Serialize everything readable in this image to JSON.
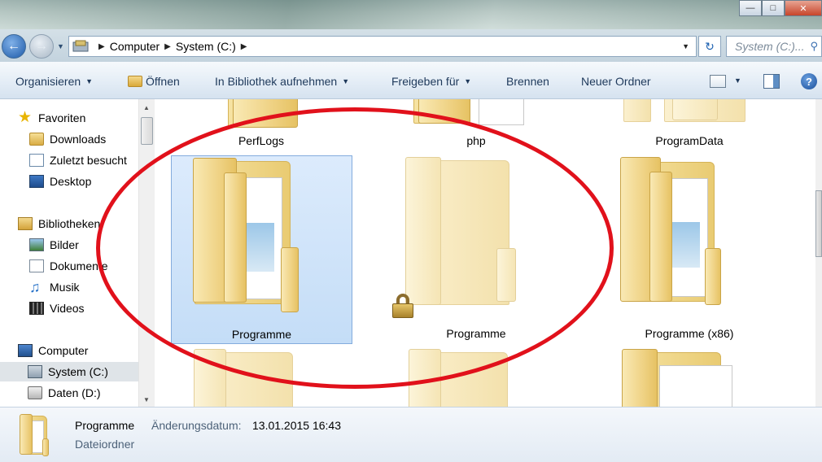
{
  "address": {
    "crumbs": [
      "Computer",
      "System (C:)"
    ],
    "search_placeholder": "System (C:)..."
  },
  "toolbar": {
    "organize": "Organisieren",
    "open": "Öffnen",
    "include_library": "In Bibliothek aufnehmen",
    "share": "Freigeben für",
    "burn": "Brennen",
    "new_folder": "Neuer Ordner"
  },
  "navigation": {
    "favorites_header": "Favoriten",
    "favorites": [
      "Downloads",
      "Zuletzt besucht",
      "Desktop"
    ],
    "libraries_header": "Bibliotheken",
    "libraries": [
      "Bilder",
      "Dokumente",
      "Musik",
      "Videos"
    ],
    "computer_header": "Computer",
    "drives": [
      "System (C:)",
      "Daten (D:)"
    ],
    "selected": "System (C:)"
  },
  "folders": [
    {
      "name": "PerfLogs"
    },
    {
      "name": "php"
    },
    {
      "name": "ProgramData"
    },
    {
      "name": "Programme",
      "state": "selected"
    },
    {
      "name": "Programme",
      "state": "locked"
    },
    {
      "name": "Programme (x86)"
    }
  ],
  "details": {
    "name": "Programme",
    "date_label": "Änderungsdatum:",
    "date_value": "13.01.2015 16:43",
    "type": "Dateiordner"
  },
  "annotation": {
    "color": "#e1111b",
    "shape": "ellipse"
  }
}
